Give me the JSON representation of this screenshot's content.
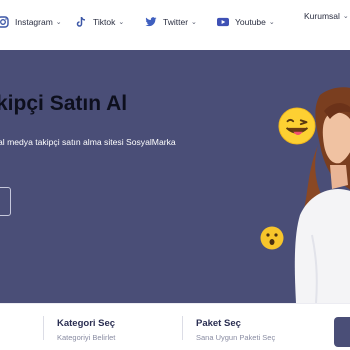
{
  "nav": {
    "items": [
      {
        "label": "Instagram",
        "icon": "instagram-icon"
      },
      {
        "label": "Tiktok",
        "icon": "tiktok-icon"
      },
      {
        "label": "Twitter",
        "icon": "twitter-icon"
      },
      {
        "label": "Youtube",
        "icon": "youtube-icon"
      }
    ],
    "kurumsal": "Kurumsal",
    "chevron": "⌄"
  },
  "hero": {
    "title": "kipçi Satın Al",
    "subtitle": "al medya takipçi satın alma sitesi SosyalMarka"
  },
  "steps": [
    {
      "title": "Kategori Seç",
      "subtitle": "Kategoriyi Belirlet"
    },
    {
      "title": "Paket Seç",
      "subtitle": "Sana Uygun Paketi Seç"
    }
  ],
  "colors": {
    "hero_bg": "#4a4e77",
    "instagram": "#3b56a6",
    "twitter": "#1d9bf0",
    "youtube": "#3f51b5",
    "step_title": "#2a2e52"
  }
}
